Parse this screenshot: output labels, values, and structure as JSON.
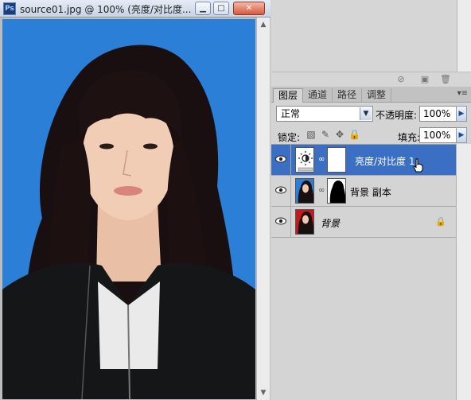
{
  "document": {
    "title": "source01.jpg @ 100% (亮度/对比度...",
    "app_badge": "Ps",
    "minimize_icon": "minimize-icon",
    "maximize_icon": "maximize-icon",
    "close_icon": "close-icon"
  },
  "layers_panel": {
    "tabs": [
      {
        "label": "图层",
        "active": true
      },
      {
        "label": "通道",
        "active": false
      },
      {
        "label": "路径",
        "active": false
      },
      {
        "label": "调整",
        "active": false
      }
    ],
    "blend_mode": "正常",
    "opacity_label": "不透明度:",
    "opacity_value": "100%",
    "lock_label": "锁定:",
    "fill_label": "填充:",
    "fill_value": "100%",
    "layers": [
      {
        "name": "亮度/对比度 1",
        "selected": true,
        "type": "adjustment"
      },
      {
        "name": "背景 副本",
        "selected": false,
        "type": "masked-image"
      },
      {
        "name": "背景",
        "selected": false,
        "type": "background",
        "locked": true
      }
    ]
  },
  "colors": {
    "photo_bg": "#2b7fd6",
    "selection": "#3b6fc4"
  }
}
